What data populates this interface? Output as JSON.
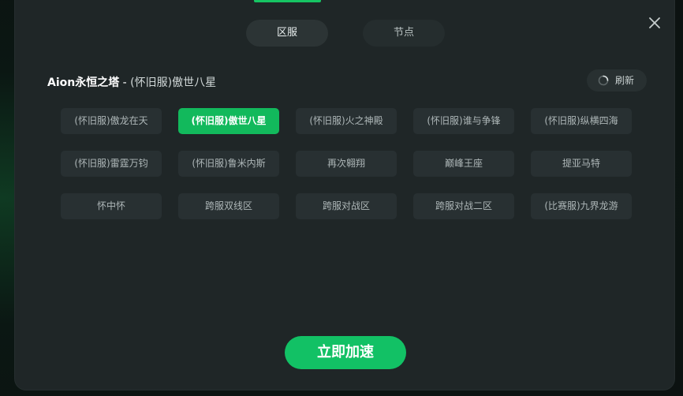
{
  "tabs": [
    {
      "label": "区服",
      "active": true
    },
    {
      "label": "节点",
      "active": false
    }
  ],
  "game": {
    "name": "Aion永恒之塔",
    "separator": " - ",
    "server": "(怀旧服)傲世八星"
  },
  "refresh_label": "刷新",
  "servers": [
    {
      "label": "(怀旧服)傲龙在天",
      "selected": false
    },
    {
      "label": "(怀旧服)傲世八星",
      "selected": true
    },
    {
      "label": "(怀旧服)火之神殿",
      "selected": false
    },
    {
      "label": "(怀旧服)谁与争锋",
      "selected": false
    },
    {
      "label": "(怀旧服)纵横四海",
      "selected": false
    },
    {
      "label": "(怀旧服)雷霆万钧",
      "selected": false
    },
    {
      "label": "(怀旧服)鲁米内斯",
      "selected": false
    },
    {
      "label": "再次翱翔",
      "selected": false
    },
    {
      "label": "巅峰王座",
      "selected": false
    },
    {
      "label": "提亚马特",
      "selected": false
    },
    {
      "label": "怀中怀",
      "selected": false
    },
    {
      "label": "跨服双线区",
      "selected": false
    },
    {
      "label": "跨服对战区",
      "selected": false
    },
    {
      "label": "跨服对战二区",
      "selected": false
    },
    {
      "label": "(比赛服)九界龙游",
      "selected": false
    }
  ],
  "accelerate_label": "立即加速",
  "colors": {
    "accent": "#12c165",
    "modal_bg": "#1f2627",
    "button_bg": "#283032"
  },
  "icons": {
    "close": "close-icon",
    "refresh": "refresh-spinner-icon"
  }
}
